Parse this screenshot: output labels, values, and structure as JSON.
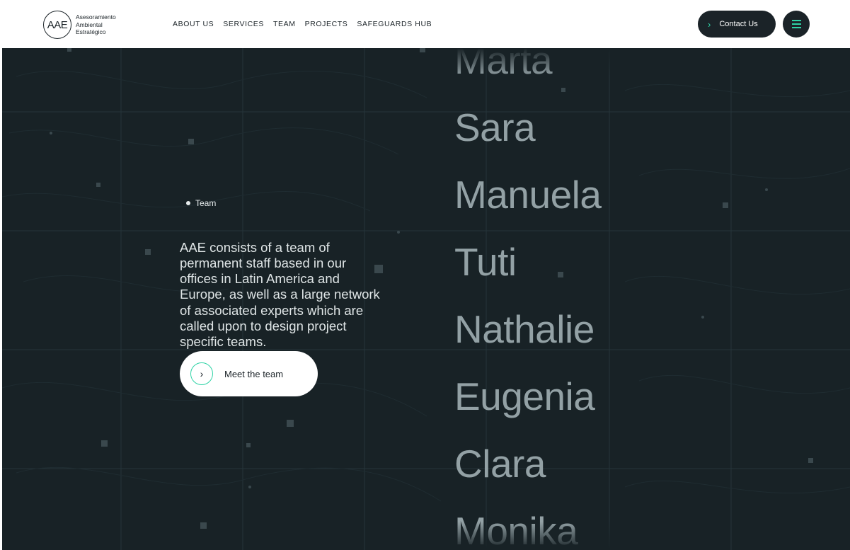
{
  "header": {
    "logo": {
      "mark": "AAE",
      "lines": [
        "Asesoramiento",
        "Ambiental",
        "Estratégico"
      ]
    },
    "nav": [
      "ABOUT US",
      "SERVICES",
      "TEAM",
      "PROJECTS",
      "SAFEGUARDS HUB"
    ],
    "contact_label": "Contact Us",
    "icons": {
      "contact": "chevron-right-icon",
      "menu": "hamburger-menu-icon"
    }
  },
  "hero": {
    "eyebrow": "Team",
    "lead": "AAE consists of a team of permanent staff based in our offices in Latin America and Europe, as well as a large network of associated experts which are called upon to design project specific teams.",
    "cta_label": "Meet the team",
    "names": [
      "Marta",
      "Sara",
      "Manuela",
      "Tuti",
      "Nathalie",
      "Eugenia",
      "Clara",
      "Monika"
    ]
  },
  "colors": {
    "background": "#182226",
    "accent": "#2fd3a6",
    "dark_button": "#1b2328",
    "name_text": "#93a1a5"
  }
}
